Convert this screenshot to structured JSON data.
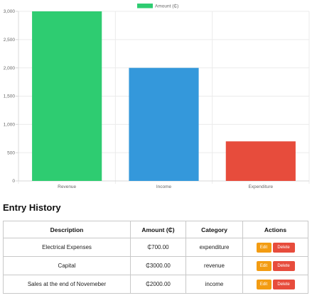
{
  "colors": {
    "revenue": "#2ecc71",
    "income": "#3498db",
    "expenditure": "#e74c3c",
    "legend": "#2ecc71",
    "edit_button": "#f39c12",
    "delete_button": "#e74c3c"
  },
  "chart_data": {
    "type": "bar",
    "categories": [
      "Revenue",
      "Income",
      "Expenditure"
    ],
    "series": [
      {
        "name": "Amount (₵)",
        "values": [
          3000,
          2000,
          700
        ]
      }
    ],
    "bar_colors": [
      "#2ecc71",
      "#3498db",
      "#e74c3c"
    ],
    "title": "",
    "xlabel": "",
    "ylabel": "",
    "ylim": [
      0,
      3000
    ],
    "yticks": [
      0,
      500,
      1000,
      1500,
      2000,
      2500,
      3000
    ],
    "ytick_labels": [
      "0",
      "500",
      "1,000",
      "1,500",
      "2,000",
      "2,500",
      "3,000"
    ],
    "grid": true,
    "legend": "top-center"
  },
  "section": {
    "title": "Entry History"
  },
  "table": {
    "headers": [
      "Description",
      "Amount (₵)",
      "Category",
      "Actions"
    ],
    "rows": [
      {
        "description": "Electrical Expenses",
        "amount": "₵700.00",
        "category": "expenditure"
      },
      {
        "description": "Capital",
        "amount": "₵3000.00",
        "category": "revenue"
      },
      {
        "description": "Sales at the end of Novemeber",
        "amount": "₵2000.00",
        "category": "income"
      }
    ],
    "edit_label": "Edit",
    "delete_label": "Delete"
  }
}
